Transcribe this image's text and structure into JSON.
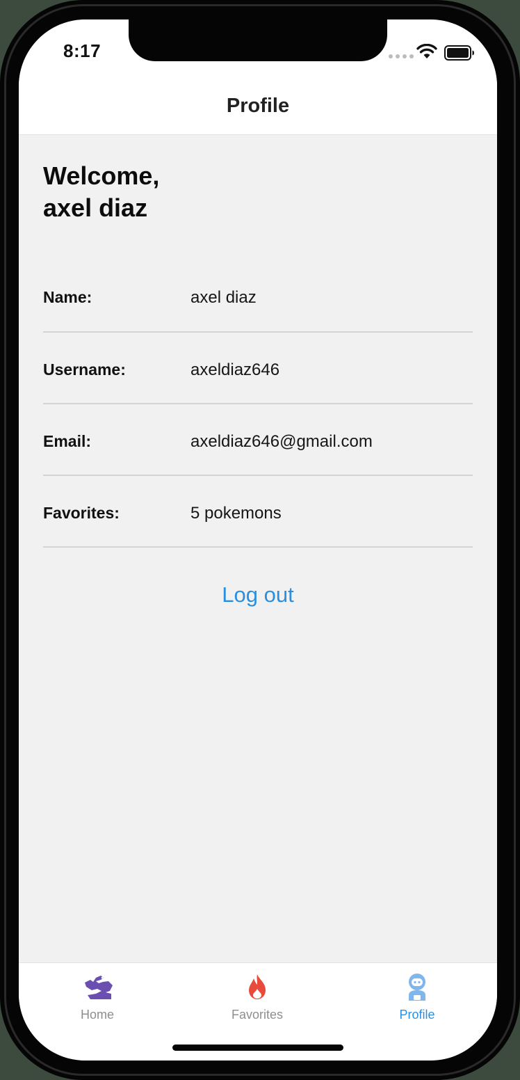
{
  "status_bar": {
    "time": "8:17"
  },
  "nav": {
    "title": "Profile"
  },
  "welcome": {
    "line1": "Welcome,",
    "line2": "axel diaz"
  },
  "profile_rows": [
    {
      "label": "Name:",
      "value": "axel diaz"
    },
    {
      "label": "Username:",
      "value": "axeldiaz646"
    },
    {
      "label": "Email:",
      "value": "axeldiaz646@gmail.com"
    },
    {
      "label": "Favorites:",
      "value": "5 pokemons"
    }
  ],
  "logout_label": "Log out",
  "tabs": [
    {
      "label": "Home",
      "icon": "dragon-icon",
      "color": "#6a4fb0"
    },
    {
      "label": "Favorites",
      "icon": "flame-icon",
      "color": "#e84b3c"
    },
    {
      "label": "Profile",
      "icon": "astronaut-icon",
      "color": "#2b8fe0",
      "active": true
    }
  ],
  "colors": {
    "accent": "#2b8fe0",
    "background": "#f1f1f1",
    "tab_inactive": "#8e8e8e"
  }
}
